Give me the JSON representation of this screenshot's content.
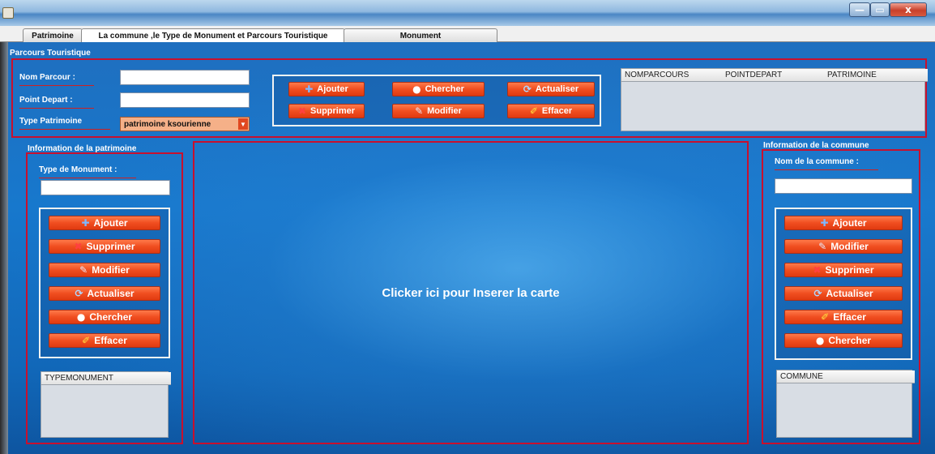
{
  "window": {
    "title": "",
    "buttons": {
      "minimize": "—",
      "maximize": "▭",
      "close": "x"
    }
  },
  "tabs": [
    {
      "label": "Patrimoine",
      "selected": false
    },
    {
      "label": "La commune ,le  Type de Monument et Parcours Touristique",
      "selected": true
    },
    {
      "label": "Monument",
      "selected": false
    }
  ],
  "parcours": {
    "section_title": "Parcours Touristique",
    "nom_label": "Nom Parcour  :",
    "nom_value": "",
    "point_label": "Point Depart  :",
    "point_value": "",
    "type_label": "Type Patrimoine",
    "type_selected": "patrimoine ksourienne",
    "buttons": {
      "ajouter": "Ajouter",
      "chercher": "Chercher",
      "actualiser": "Actualiser",
      "supprimer": "Supprimer",
      "modifier": "Modifier",
      "effacer": "Effacer"
    },
    "table_headers": [
      "NOMPARCOURS",
      "POINTDEPART",
      "PATRIMOINE"
    ]
  },
  "patrimoine": {
    "section_title": "Information de la patrimoine",
    "type_label": "Type de Monument  :",
    "type_value": "",
    "buttons": {
      "ajouter": "Ajouter",
      "supprimer": "Supprimer",
      "modifier": "Modifier",
      "actualiser": "Actualiser",
      "chercher": "Chercher",
      "effacer": "Effacer"
    },
    "table_header": "TYPEMONUMENT"
  },
  "map": {
    "placeholder": "Clicker ici pour Inserer la carte"
  },
  "commune": {
    "section_title": "Information de la commune",
    "nom_label": "Nom de la commune :",
    "nom_value": "",
    "buttons": {
      "ajouter": "Ajouter",
      "modifier": "Modifier",
      "supprimer": "Supprimer",
      "actualiser": "Actualiser",
      "effacer": "Effacer",
      "chercher": "Chercher"
    },
    "table_header": "COMMUNE"
  },
  "icons": {
    "ajouter": "plus-icon",
    "supprimer": "cross-icon",
    "modifier": "pencil-icon",
    "actualiser": "refresh-icon",
    "chercher": "search-icon",
    "effacer": "eraser-icon"
  },
  "colors": {
    "accent": "#f04e20",
    "border_red": "#c8102e",
    "desktop": "#1778cd"
  }
}
